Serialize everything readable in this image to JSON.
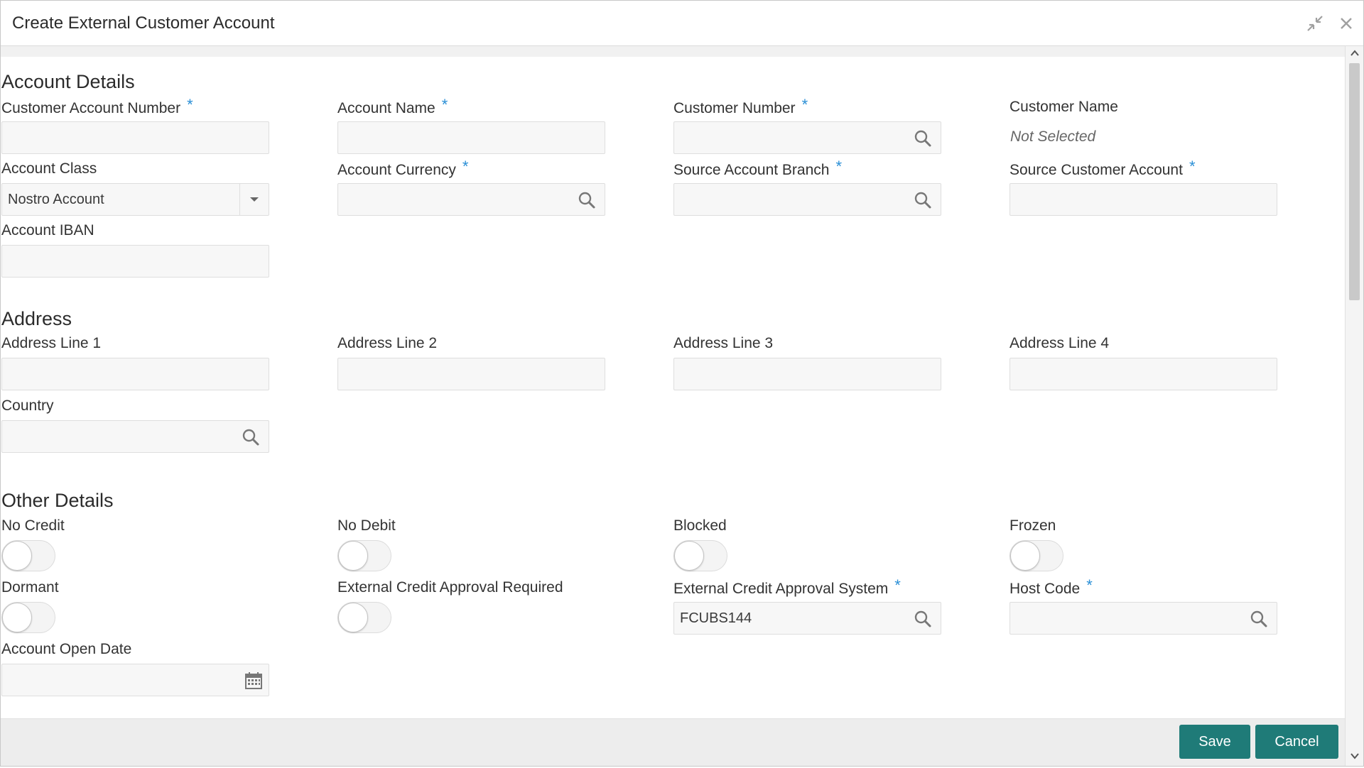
{
  "window": {
    "title": "Create External Customer Account",
    "icons": {
      "minimize": "collapse-icon",
      "close": "close-icon"
    }
  },
  "sections": {
    "account_details": "Account Details",
    "address": "Address",
    "other_details": "Other Details"
  },
  "fields": {
    "customer_account_number": {
      "label": "Customer Account Number",
      "required": "*",
      "value": ""
    },
    "account_name": {
      "label": "Account Name",
      "required": "*",
      "value": ""
    },
    "customer_number": {
      "label": "Customer Number",
      "required": "*",
      "value": ""
    },
    "customer_name": {
      "label": "Customer Name",
      "value": "Not Selected"
    },
    "account_class": {
      "label": "Account Class",
      "value": "Nostro Account"
    },
    "account_currency": {
      "label": "Account Currency",
      "required": "*",
      "value": ""
    },
    "source_account_branch": {
      "label": "Source Account Branch",
      "required": "*",
      "value": ""
    },
    "source_customer_account": {
      "label": "Source Customer Account",
      "required": "*",
      "value": ""
    },
    "account_iban": {
      "label": "Account IBAN",
      "value": ""
    },
    "address_line_1": {
      "label": "Address Line 1",
      "value": ""
    },
    "address_line_2": {
      "label": "Address Line 2",
      "value": ""
    },
    "address_line_3": {
      "label": "Address Line 3",
      "value": ""
    },
    "address_line_4": {
      "label": "Address Line 4",
      "value": ""
    },
    "country": {
      "label": "Country",
      "value": ""
    },
    "no_credit": {
      "label": "No Credit",
      "on": false
    },
    "no_debit": {
      "label": "No Debit",
      "on": false
    },
    "blocked": {
      "label": "Blocked",
      "on": false
    },
    "frozen": {
      "label": "Frozen",
      "on": false
    },
    "dormant": {
      "label": "Dormant",
      "on": false
    },
    "external_credit_approval_required": {
      "label": "External Credit Approval Required",
      "on": false
    },
    "external_credit_approval_system": {
      "label": "External Credit Approval System",
      "required": "*",
      "value": "FCUBS144"
    },
    "host_code": {
      "label": "Host Code",
      "required": "*",
      "value": ""
    },
    "account_open_date": {
      "label": "Account Open Date",
      "value": ""
    }
  },
  "footer": {
    "save": "Save",
    "cancel": "Cancel"
  },
  "colors": {
    "accent": "#1f7b78",
    "required": "#2a8fd6",
    "field_bg": "#f7f7f7"
  }
}
